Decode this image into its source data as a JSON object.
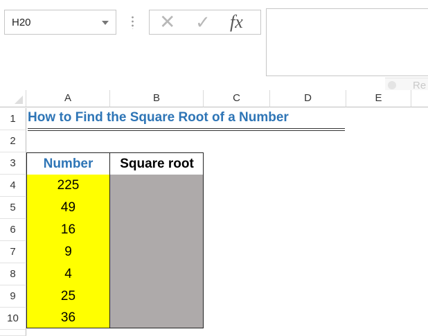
{
  "name_box": {
    "value": "H20"
  },
  "formula_bar": {
    "icons": [
      "cancel-icon",
      "enter-icon",
      "insert-function-icon"
    ],
    "fx_label": "fx",
    "content": ""
  },
  "ghost": {
    "text": "Re"
  },
  "columns": [
    "A",
    "B",
    "C",
    "D",
    "E"
  ],
  "rows": [
    "1",
    "2",
    "3",
    "4",
    "5",
    "6",
    "7",
    "8",
    "9",
    "10"
  ],
  "sheet": {
    "title": "How to Find the Square Root of a Number",
    "table": {
      "headers": [
        "Number",
        "Square root"
      ],
      "numbers": [
        "225",
        "49",
        "16",
        "9",
        "4",
        "25",
        "36"
      ],
      "square_roots": [
        "",
        "",
        "",
        "",
        "",
        "",
        ""
      ]
    }
  },
  "colors": {
    "title": "#2e75b6",
    "number_fill": "#ffff00",
    "result_fill": "#aeaaaa"
  }
}
